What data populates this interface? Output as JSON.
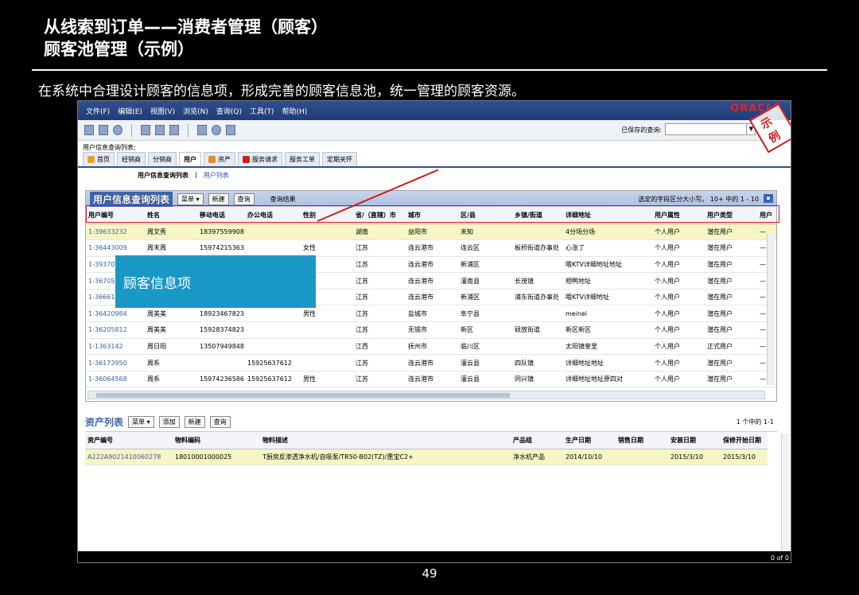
{
  "slide": {
    "title_line1": "从线索到订单——消费者管理（顾客）",
    "title_line2": "顾客池管理（示例）",
    "subtitle": "在系统中合理设计顾客的信息项，形成完善的顾客信息池，统一管理的顾客资源。",
    "page_number": "49",
    "callout": "顾客信息项",
    "stamp": "示例"
  },
  "app": {
    "menu": [
      "文件(F)",
      "编辑(E)",
      "视图(V)",
      "浏览(N)",
      "查询(Q)",
      "工具(T)",
      "帮助(H)"
    ],
    "brand": "ORACLE",
    "saved_query_label": "已保存的查询:",
    "breadcrumb": "用户信息查询列表:",
    "tabs": [
      "首页",
      "经销商",
      "分销商",
      "用户",
      "资产",
      "服务请求",
      "服务工单",
      "定期关怀"
    ],
    "subtabs": [
      "用户信息查询列表",
      "用户列表"
    ]
  },
  "user_panel": {
    "title": "用户信息查询列表",
    "menu_button": "菜单",
    "new_button": "新建",
    "query_button": "查询",
    "query_result": "查询结果",
    "header_right": "选定的字段区分大小写。 10+ 中的 1 - 10",
    "columns": [
      "用户编号",
      "姓名",
      "移动电话",
      "办公电话",
      "性别",
      "省/（直辖）市",
      "城市",
      "区/县",
      "乡镇/街道",
      "详细地址",
      "用户属性",
      "用户类型",
      "用户"
    ],
    "rows": [
      [
        "1-39633232",
        "周文秀",
        "18397559908",
        "",
        "",
        "湖南",
        "益阳市",
        "未知",
        "",
        "4分场分场",
        "个人用户",
        "潜在用户",
        "—"
      ],
      [
        "1-36443009",
        "周末周",
        "15974215363",
        "",
        "女性",
        "江苏",
        "连云港市",
        "连云区",
        "板桥街道办事处",
        "心涨了",
        "个人用户",
        "潜在用户",
        "—"
      ],
      [
        "1-39370",
        "",
        "",
        "",
        "",
        "江苏",
        "连云港市",
        "新浦区",
        "",
        "哦KTV详细地址地址",
        "个人用户",
        "潜在用户",
        "—"
      ],
      [
        "1-36705",
        "",
        "",
        "",
        "",
        "江苏",
        "连云港市",
        "灌南县",
        "长茂镇",
        "相鸭地址",
        "个人用户",
        "潜在用户",
        "—"
      ],
      [
        "1-36661",
        "",
        "",
        "",
        "",
        "江苏",
        "连云港市",
        "新浦区",
        "浦东街道办事处",
        "哦KTV详细地址",
        "个人用户",
        "潜在用户",
        "—"
      ],
      [
        "1-36420984",
        "周美美",
        "18923467823",
        "",
        "男性",
        "江苏",
        "盐城市",
        "阜宁县",
        "",
        "meinei",
        "个人用户",
        "潜在用户",
        "—"
      ],
      [
        "1-36205812",
        "周美美",
        "15928374823",
        "",
        "",
        "江苏",
        "无锡市",
        "新区",
        "硕放街道",
        "新区新区",
        "个人用户",
        "潜在用户",
        "—"
      ],
      [
        "1-1363142",
        "周日阳",
        "13507949848",
        "",
        "",
        "江西",
        "抚州市",
        "临川区",
        "",
        "太阳镇奎里",
        "个人用户",
        "正式用户",
        "—"
      ],
      [
        "1-36173950",
        "周系",
        "",
        "15925637612",
        "",
        "江苏",
        "连云港市",
        "灌云县",
        "四队镇",
        "详细地址地址",
        "个人用户",
        "潜在用户",
        "—"
      ],
      [
        "1-36064568",
        "周系",
        "15974236586",
        "15925637612",
        "男性",
        "江苏",
        "连云港市",
        "灌云县",
        "同兴镇",
        "详细地址地址原四对",
        "个人用户",
        "潜在用户",
        "—"
      ]
    ]
  },
  "asset_panel": {
    "title": "资产列表",
    "menu_button": "菜单",
    "add_button": "添加",
    "new_button": "新建",
    "query_button": "查询",
    "header_right": "1 个中的 1-1",
    "columns": [
      "资产编号",
      "物料编码",
      "物料描述",
      "产品组",
      "生产日期",
      "销售日期",
      "安装日期",
      "保修开始日期"
    ],
    "rows": [
      [
        "A222A9021410060278",
        "18010001000025",
        "T厨房反渗透净水机/自吸泵/TR50-B02(TZ)/惠宝C2+",
        "净水机产品",
        "2014/10/10",
        "",
        "2015/3/10",
        "2015/3/10"
      ]
    ]
  },
  "status": {
    "right": "0 of 0"
  },
  "colors": {
    "accent_blue": "#2f4f8e",
    "callout": "#1a98c5",
    "highlight_red": "#d01c1c",
    "selected_row": "#f7f5c3"
  }
}
